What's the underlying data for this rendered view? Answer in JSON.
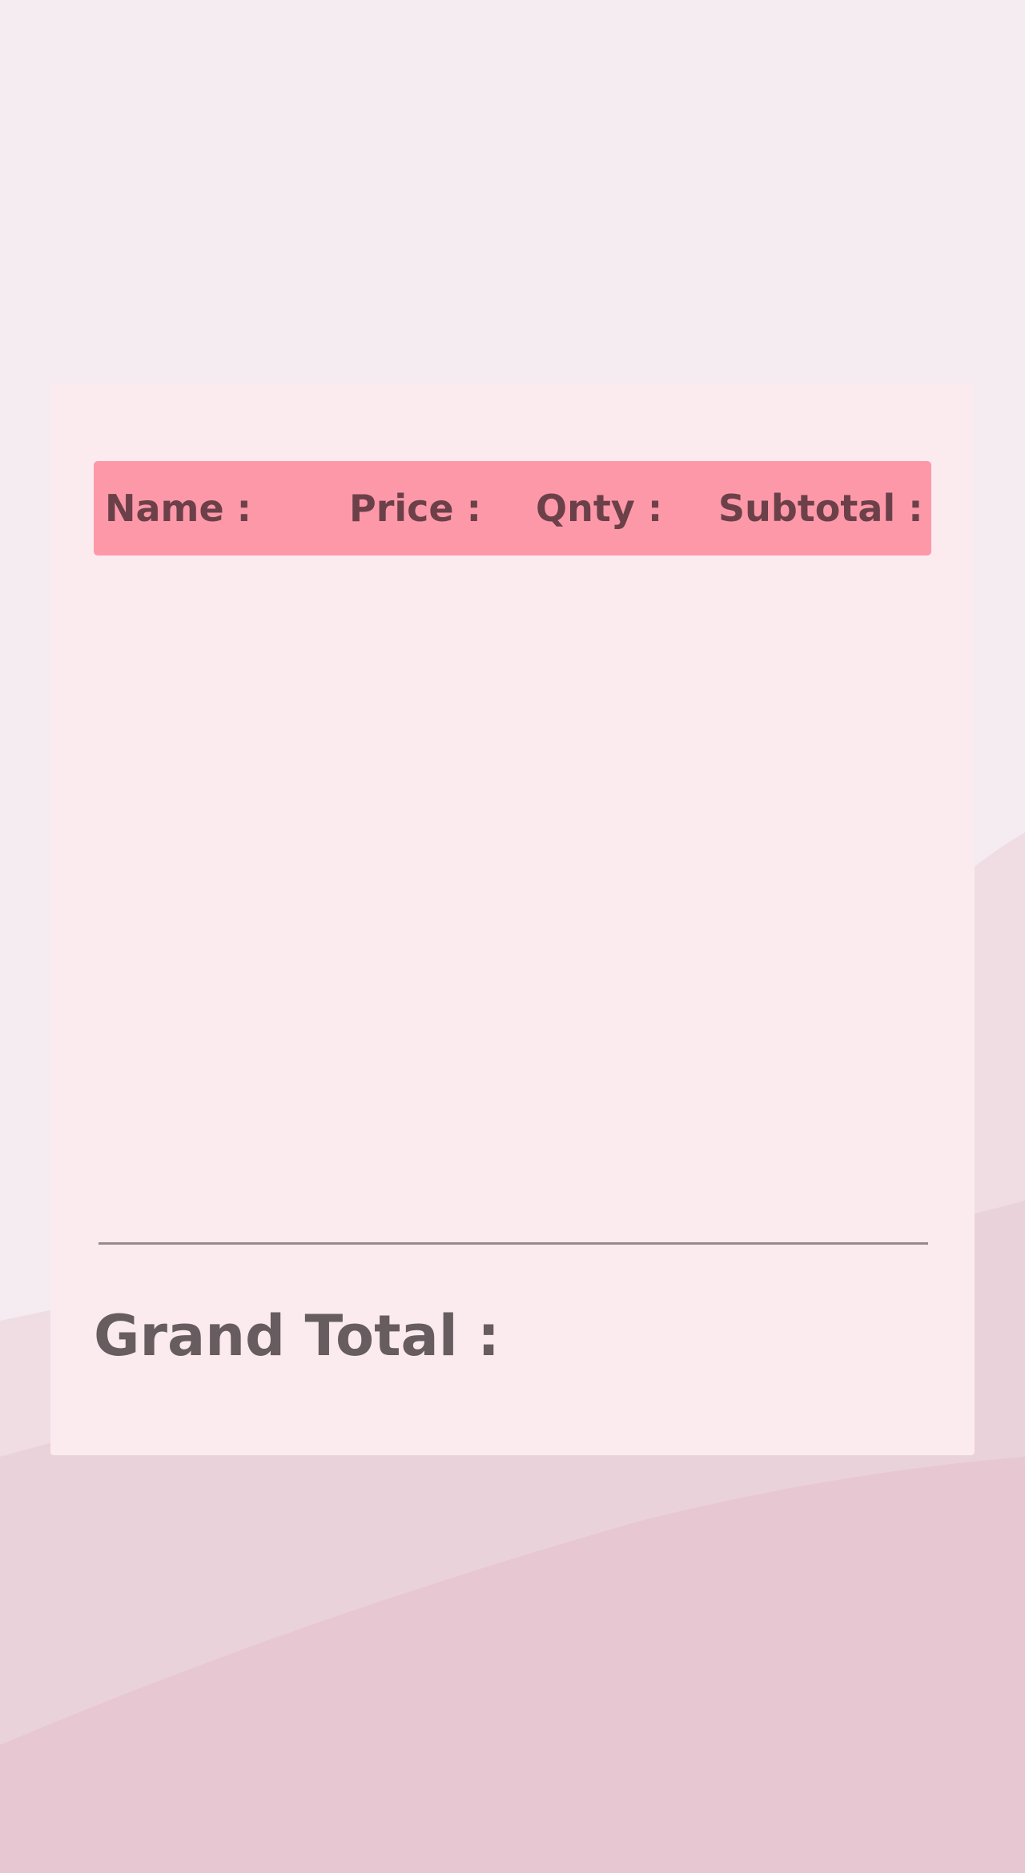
{
  "cart": {
    "header": {
      "name_label": "Name :",
      "price_label": "Price :",
      "qnty_label": "Qnty :",
      "subtotal_label": "Subtotal :"
    },
    "items": [],
    "grand_total_label": "Grand Total :"
  },
  "colors": {
    "page_background": "#f3eaee",
    "card_background": "#fbebef",
    "header_background": "#fd98a9",
    "header_text": "#6b4049",
    "grand_total_text": "#675c5f",
    "divider": "#958b8e"
  }
}
